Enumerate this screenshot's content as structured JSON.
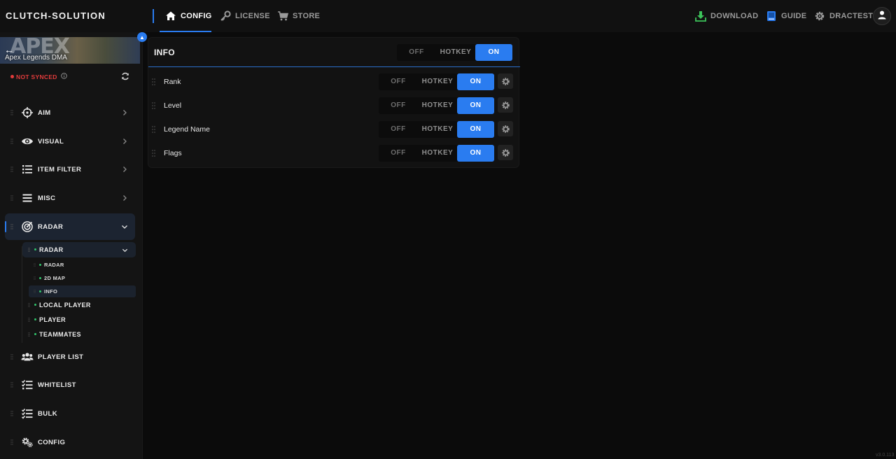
{
  "brand": "CLUTCH-SOLUTION",
  "top_nav": {
    "config": "CONFIG",
    "license": "LICENSE",
    "store": "STORE",
    "download": "DOWNLOAD",
    "guide": "GUIDE",
    "user": "DRACTEST"
  },
  "game": {
    "banner_text": "APEX",
    "title": "Apex Legends DMA",
    "sync_status": "NOT SYNCED"
  },
  "sidebar": {
    "aim": "AIM",
    "visual": "VISUAL",
    "item_filter": "ITEM FILTER",
    "misc": "MISC",
    "radar": "RADAR",
    "radar_sub": "RADAR",
    "radar_radar": "RADAR",
    "radar_2dmap": "2D MAP",
    "radar_info": "INFO",
    "local_player": "LOCAL PLAYER",
    "player": "PLAYER",
    "teammates": "TEAMMATES",
    "player_list": "PLAYER LIST",
    "whitelist": "WHITELIST",
    "bulk": "BULK",
    "config": "CONFIG"
  },
  "panel": {
    "title": "INFO",
    "opt_off": "OFF",
    "opt_hotkey": "HOTKEY",
    "opt_on": "ON",
    "master_state": "ON",
    "rows": [
      {
        "label": "Rank",
        "state": "ON"
      },
      {
        "label": "Level",
        "state": "ON"
      },
      {
        "label": "Legend Name",
        "state": "ON"
      },
      {
        "label": "Flags",
        "state": "ON"
      }
    ]
  },
  "colors": {
    "accent": "#2a7cf0",
    "status_error": "#e23b3b",
    "status_ok": "#31c46b",
    "download_icon": "#3cc35a"
  },
  "version": "v3.0.113"
}
